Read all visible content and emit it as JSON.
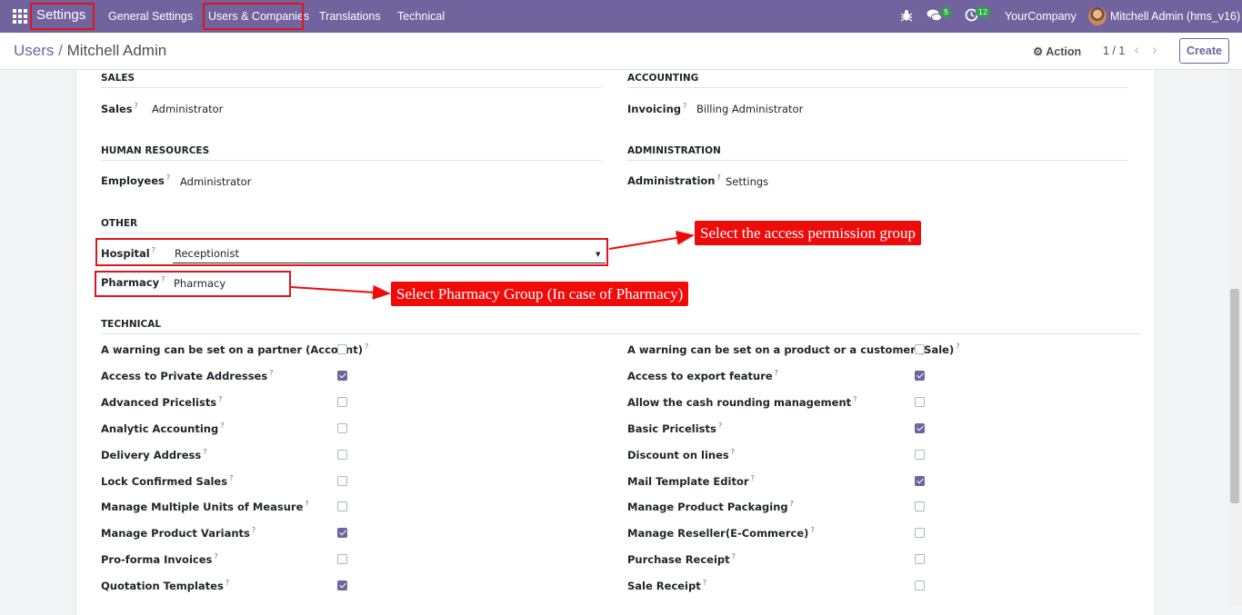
{
  "navbar": {
    "brand": "Settings",
    "menus": [
      "General Settings",
      "Users & Companies",
      "Translations",
      "Technical"
    ],
    "chat_badge": "5",
    "activity_badge": "12",
    "company": "YourCompany",
    "user": "Mitchell Admin (hms_v16)",
    "icons": [
      "apps-grid-icon",
      "bug-icon",
      "chat-icon",
      "clock-icon"
    ]
  },
  "control_panel": {
    "breadcrumb_parent": "Users",
    "breadcrumb_sep": "/",
    "breadcrumb_current": "Mitchell Admin",
    "action_label": "Action",
    "pager_value": "1 / 1",
    "create_label": "Create"
  },
  "sections": {
    "sales": {
      "title": "SALES",
      "label": "Sales",
      "help": "?",
      "value": "Administrator"
    },
    "accounting": {
      "title": "ACCOUNTING",
      "label": "Invoicing",
      "help": "?",
      "value": "Billing Administrator"
    },
    "hr": {
      "title": "HUMAN RESOURCES",
      "label": "Employees",
      "help": "?",
      "value": "Administrator"
    },
    "administration": {
      "title": "ADMINISTRATION",
      "label": "Administration",
      "help": "?",
      "value": "Settings"
    },
    "other": {
      "title": "OTHER",
      "hospital_label": "Hospital",
      "hospital_value": "Receptionist",
      "pharmacy_label": "Pharmacy",
      "pharmacy_value": "Pharmacy"
    },
    "technical": {
      "title": "TECHNICAL",
      "left": [
        {
          "label": "A warning can be set on a partner (Account)",
          "checked": false
        },
        {
          "label": "Access to Private Addresses",
          "checked": true
        },
        {
          "label": "Advanced Pricelists",
          "checked": false
        },
        {
          "label": "Analytic Accounting",
          "checked": false
        },
        {
          "label": "Delivery Address",
          "checked": false
        },
        {
          "label": "Lock Confirmed Sales",
          "checked": false
        },
        {
          "label": "Manage Multiple Units of Measure",
          "checked": false
        },
        {
          "label": "Manage Product Variants",
          "checked": true
        },
        {
          "label": "Pro-forma Invoices",
          "checked": false
        },
        {
          "label": "Quotation Templates",
          "checked": true
        }
      ],
      "right": [
        {
          "label": "A warning can be set on a product or a customer (Sale)",
          "checked": false
        },
        {
          "label": "Access to export feature",
          "checked": true
        },
        {
          "label": "Allow the cash rounding management",
          "checked": false
        },
        {
          "label": "Basic Pricelists",
          "checked": true
        },
        {
          "label": "Discount on lines",
          "checked": false
        },
        {
          "label": "Mail Template Editor",
          "checked": true
        },
        {
          "label": "Manage Product Packaging",
          "checked": false
        },
        {
          "label": "Manage Reseller(E-Commerce)",
          "checked": false
        },
        {
          "label": "Purchase Receipt",
          "checked": false
        },
        {
          "label": "Sale Receipt",
          "checked": false
        }
      ]
    }
  },
  "annotations": {
    "hospital_callout": "Select the access permission group",
    "pharmacy_callout": "Select Pharmacy Group (In case of Pharmacy)",
    "color": "#f00b0b"
  },
  "theme": {
    "primary": "#71639e",
    "badge_green": "#28a745"
  }
}
